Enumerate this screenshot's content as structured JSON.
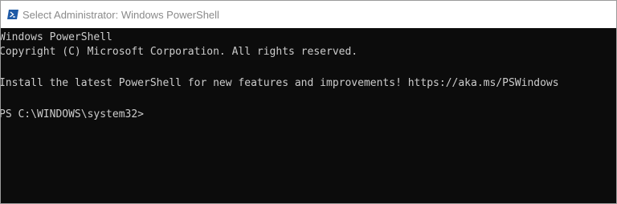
{
  "window": {
    "title": "Select Administrator: Windows PowerShell",
    "icon": "powershell-icon",
    "accent": "#1f5aa6",
    "console_bg": "#0c0c0c",
    "console_fg": "#cccccc"
  },
  "console": {
    "lines": [
      "Windows PowerShell",
      "Copyright (C) Microsoft Corporation. All rights reserved.",
      "",
      "Install the latest PowerShell for new features and improvements! https://aka.ms/PSWindows",
      "",
      "PS C:\\WINDOWS\\system32>"
    ]
  }
}
